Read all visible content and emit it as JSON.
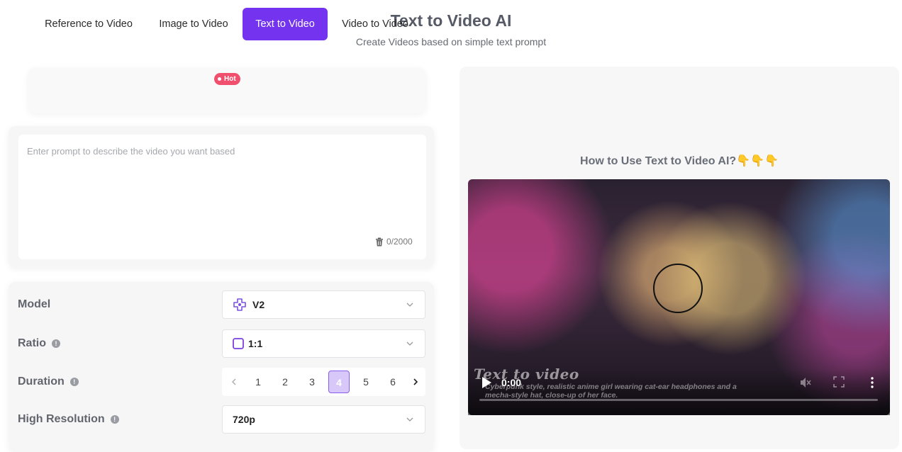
{
  "header": {
    "title": "Text to Video AI",
    "subtitle": "Create Videos based on simple text prompt"
  },
  "tabs": [
    {
      "label": "Reference to Video",
      "active": false
    },
    {
      "label": "Image to Video",
      "active": false,
      "badge": "Hot"
    },
    {
      "label": "Text to Video",
      "active": true
    },
    {
      "label": "Video to Video",
      "active": false
    }
  ],
  "prompt": {
    "placeholder": "Enter prompt to describe the video you want based",
    "value": "",
    "char_count": "0/2000"
  },
  "settings": {
    "model": {
      "label": "Model",
      "value": "V2",
      "icon": "model-v2-icon"
    },
    "ratio": {
      "label": "Ratio",
      "value": "1:1",
      "icon": "square-ratio-icon"
    },
    "duration": {
      "label": "Duration",
      "options": [
        "1",
        "2",
        "3",
        "4",
        "5",
        "6"
      ],
      "selected": "4"
    },
    "resolution": {
      "label": "High Resolution",
      "value": "720p"
    }
  },
  "howto": {
    "title": "How to Use Text to Video AI?👇👇👇"
  },
  "video": {
    "watermark": "Text to video",
    "caption": "Cyberpunk style, realistic anime girl wearing cat-ear headphones and a mecha-style hat, close-up of her face.",
    "time": "0:00",
    "progress": 0
  },
  "colors": {
    "accent": "#7433ee",
    "hot_badge": "#f0506e",
    "card_bg": "#f6f6f7"
  }
}
